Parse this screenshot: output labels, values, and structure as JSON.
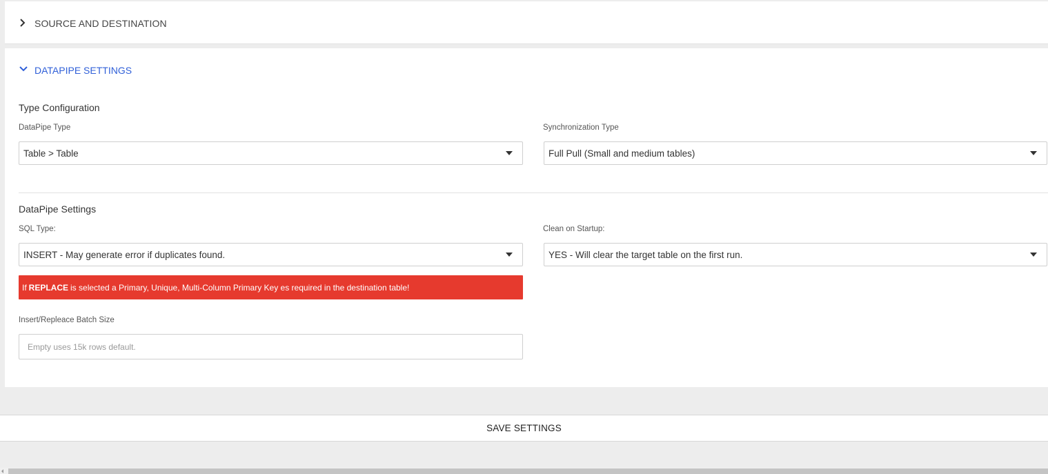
{
  "panels": {
    "source_destination": {
      "title": "SOURCE AND DESTINATION",
      "expanded": false
    },
    "datapipe_settings": {
      "title": "DATAPIPE SETTINGS",
      "expanded": true
    }
  },
  "type_configuration": {
    "title": "Type Configuration",
    "datapipe_type": {
      "label": "DataPipe Type",
      "value": "Table > Table"
    },
    "synchronization_type": {
      "label": "Synchronization Type",
      "value": "Full Pull (Small and medium tables)"
    }
  },
  "datapipe_settings": {
    "title": "DataPipe Settings",
    "sql_type": {
      "label": "SQL Type:",
      "value": "INSERT - May generate error if duplicates found."
    },
    "clean_on_startup": {
      "label": "Clean on Startup:",
      "value": "YES - Will clear the target table on the first run."
    },
    "alert": {
      "prefix": "If",
      "emphasis": "REPLACE",
      "suffix": "is selected a Primary, Unique, Multi-Column Primary Key es required in the destination table!",
      "color": "#e63a2e"
    },
    "batch_size": {
      "label": "Insert/Repleace Batch Size",
      "value": "",
      "placeholder": "Empty uses 15k rows default."
    }
  },
  "actions": {
    "save_label": "SAVE SETTINGS"
  },
  "colors": {
    "accent": "#2f5fd8",
    "alert": "#e63a2e",
    "background": "#ededed"
  }
}
